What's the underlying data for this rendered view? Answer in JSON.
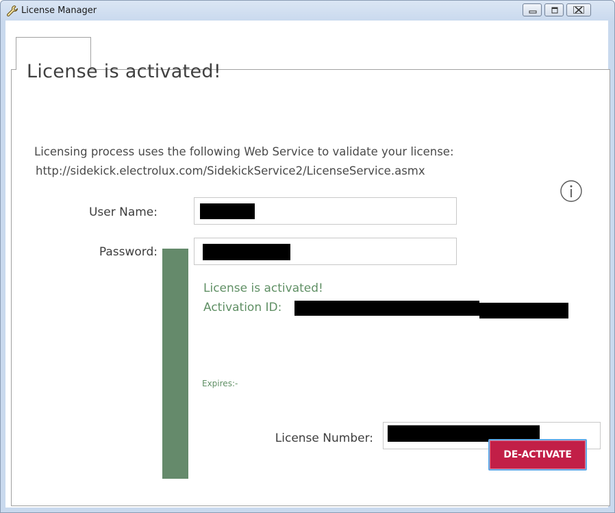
{
  "window": {
    "title": "License Manager",
    "icon": "wrench-icon",
    "controls": [
      "minimize-icon",
      "maximize-icon",
      "close-icon"
    ]
  },
  "tabs": [
    {
      "label": "",
      "selected": true
    }
  ],
  "main": {
    "heading": "License is activated!",
    "info_line_1": "Licensing process uses the following Web Service to validate your license:",
    "info_line_2": "http://sidekick.electrolux.com/SidekickService2/LicenseService.asmx",
    "user_name_label": "User Name:",
    "password_label": "Password:",
    "info_icon": "info-icon"
  },
  "status": {
    "activated_text": "License is activated!",
    "activation_id_label": "Activation ID:",
    "expires_text": "Expires:-",
    "accent_color": "#658a6b"
  },
  "license": {
    "license_number_label": "License Number:",
    "deactivate_label": "DE-ACTIVATE",
    "button_color": "#c21f47"
  }
}
